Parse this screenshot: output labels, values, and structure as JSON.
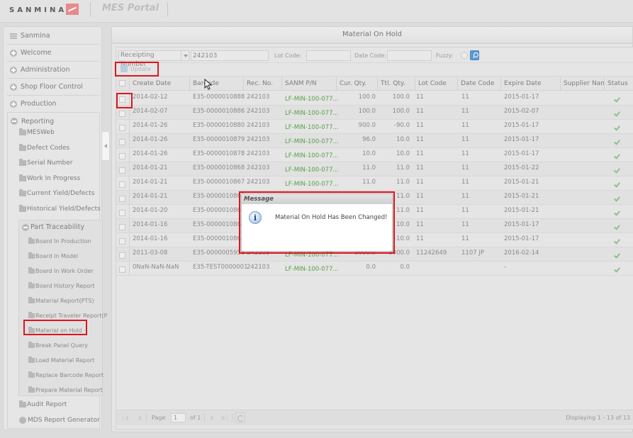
{
  "header": {
    "brand": "SANMINA",
    "portal_title": "MES Portal"
  },
  "sidebar": {
    "top_items": [
      {
        "label": "Sanmina",
        "icon": "list-icon"
      },
      {
        "label": "Welcome",
        "icon": "plus-circle-icon"
      },
      {
        "label": "Administration",
        "icon": "plus-circle-icon"
      },
      {
        "label": "Shop Floor Control",
        "icon": "plus-circle-icon"
      },
      {
        "label": "Production",
        "icon": "plus-circle-icon"
      },
      {
        "label": "Reporting",
        "icon": "minus-circle-icon"
      }
    ],
    "reporting_items": [
      {
        "label": "MESWeb"
      },
      {
        "label": "Defect Codes"
      },
      {
        "label": "Serial Number"
      },
      {
        "label": "Work In Progress"
      },
      {
        "label": "Current Yield/Defects"
      },
      {
        "label": "Historical Yield/Defects"
      }
    ],
    "part_traceability": {
      "label": "Part Traceability",
      "items": [
        {
          "label": "Board In Production"
        },
        {
          "label": "Board In Model"
        },
        {
          "label": "Board In Work Order"
        },
        {
          "label": "Board History Report"
        },
        {
          "label": "Material Report(PTS)"
        },
        {
          "label": "Receipt Traveler Report(P"
        },
        {
          "label": "Material on Hold"
        },
        {
          "label": "Break Panel Query"
        },
        {
          "label": "Load Material Report"
        },
        {
          "label": "Replace Barcode Report"
        },
        {
          "label": "Prepare Material Report"
        }
      ]
    },
    "bottom_items": [
      {
        "label": "Audit Report"
      },
      {
        "label": "MDS Report Generator"
      }
    ]
  },
  "panel": {
    "title": "Material On Hold",
    "search": {
      "field_select": "Receipting Number",
      "field_value": "242103",
      "lot_code_label": "Lot Code:",
      "lot_code_value": "",
      "date_code_label": "Date Code:",
      "date_code_value": "",
      "fuzzy_label": "Fuzzy:"
    },
    "update_label": "Update",
    "columns": [
      "Create Date",
      "Barcode",
      "Rec. No.",
      "SANM P/N",
      "Cur. Qty.",
      "Ttl. Qty.",
      "Lot Code",
      "Date Code",
      "Expire Date",
      "Supplier Nam",
      "Status"
    ],
    "rows": [
      {
        "create_date": "2014-02-12",
        "barcode": "E35-0000010888",
        "rec_no": "242103",
        "pn": "LF-MIN-100-077...",
        "cur_qty": "100.0",
        "ttl_qty": "100.0",
        "lot_code": "11",
        "date_code": "11",
        "expire_date": "2015-01-17",
        "supplier": "",
        "status": "ok"
      },
      {
        "create_date": "2014-02-07",
        "barcode": "E35-0000010886",
        "rec_no": "242103",
        "pn": "LF-MIN-100-077...",
        "cur_qty": "100.0",
        "ttl_qty": "100.0",
        "lot_code": "11",
        "date_code": "11",
        "expire_date": "2015-02-07",
        "supplier": "",
        "status": "ok"
      },
      {
        "create_date": "2014-01-26",
        "barcode": "E35-0000010880",
        "rec_no": "242103",
        "pn": "LF-MIN-100-077...",
        "cur_qty": "900.0",
        "ttl_qty": "-90.0",
        "lot_code": "11",
        "date_code": "11",
        "expire_date": "2015-01-17",
        "supplier": "",
        "status": "ok"
      },
      {
        "create_date": "2014-01-26",
        "barcode": "E35-0000010879",
        "rec_no": "242103",
        "pn": "LF-MIN-100-077...",
        "cur_qty": "96.0",
        "ttl_qty": "10.0",
        "lot_code": "11",
        "date_code": "11",
        "expire_date": "2015-01-17",
        "supplier": "",
        "status": "ok"
      },
      {
        "create_date": "2014-01-26",
        "barcode": "E35-0000010878",
        "rec_no": "242103",
        "pn": "LF-MIN-100-077...",
        "cur_qty": "10.0",
        "ttl_qty": "10.0",
        "lot_code": "11",
        "date_code": "11",
        "expire_date": "2015-01-17",
        "supplier": "",
        "status": "ok"
      },
      {
        "create_date": "2014-01-21",
        "barcode": "E35-0000010868",
        "rec_no": "242103",
        "pn": "LF-MIN-100-077...",
        "cur_qty": "11.0",
        "ttl_qty": "11.0",
        "lot_code": "11",
        "date_code": "11",
        "expire_date": "2015-01-22",
        "supplier": "",
        "status": "ok"
      },
      {
        "create_date": "2014-01-21",
        "barcode": "E35-0000010867",
        "rec_no": "242103",
        "pn": "LF-MIN-100-077...",
        "cur_qty": "11.0",
        "ttl_qty": "11.0",
        "lot_code": "11",
        "date_code": "11",
        "expire_date": "2015-01-21",
        "supplier": "",
        "status": "ok"
      },
      {
        "create_date": "2014-01-21",
        "barcode": "E35-0000010865",
        "rec_no": "",
        "pn": "",
        "cur_qty": "",
        "ttl_qty": "11.0",
        "lot_code": "11",
        "date_code": "11",
        "expire_date": "2015-01-21",
        "supplier": "",
        "status": "ok"
      },
      {
        "create_date": "2014-01-20",
        "barcode": "E35-0000010864",
        "rec_no": "",
        "pn": "",
        "cur_qty": "",
        "ttl_qty": "11.0",
        "lot_code": "11",
        "date_code": "11",
        "expire_date": "2015-01-21",
        "supplier": "",
        "status": "ok"
      },
      {
        "create_date": "2014-01-16",
        "barcode": "E35-000001086...",
        "rec_no": "",
        "pn": "",
        "cur_qty": "",
        "ttl_qty": "10.0",
        "lot_code": "11",
        "date_code": "11",
        "expire_date": "2015-01-17",
        "supplier": "",
        "status": "ok"
      },
      {
        "create_date": "2014-01-16",
        "barcode": "E35-0000010863",
        "rec_no": "",
        "pn": "",
        "cur_qty": "",
        "ttl_qty": "-10.0",
        "lot_code": "11",
        "date_code": "11",
        "expire_date": "2015-01-17",
        "supplier": "",
        "status": "ok"
      },
      {
        "create_date": "2011-03-08",
        "barcode": "E35-0000005958",
        "rec_no": "242103",
        "pn": "LF-MIN-100-077...",
        "cur_qty": "5000.0",
        "ttl_qty": "5000.0",
        "lot_code": "11242649",
        "date_code": "1107 JP",
        "expire_date": "2016-02-14",
        "supplier": "",
        "status": "ok"
      },
      {
        "create_date": "0NaN-NaN-NaN",
        "barcode": "E35-TEST0000001",
        "rec_no": "242103",
        "pn": "LF-MIN-100-077...",
        "cur_qty": "0.0",
        "ttl_qty": "0.0",
        "lot_code": "",
        "date_code": "",
        "expire_date": "-",
        "supplier": "",
        "status": "ok"
      }
    ],
    "paging": {
      "page_label": "Page",
      "page_value": "1",
      "of_label": "of 1",
      "display_text": "Displaying 1 - 13 of 13"
    }
  },
  "dialog": {
    "title": "Message",
    "message": "Material On Hold Has Been Changed!",
    "icon": "info-icon"
  },
  "colors": {
    "highlight": "#e0141e",
    "pn_text": "#5aa04a",
    "status_ok": "#8cc08c"
  }
}
